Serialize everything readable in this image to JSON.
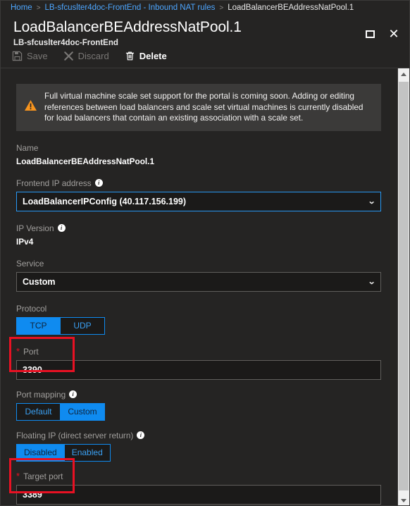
{
  "breadcrumb": {
    "home": "Home",
    "parent": "LB-sfcuslter4doc-FrontEnd - Inbound NAT rules",
    "current": "LoadBalancerBEAddressNatPool.1",
    "separator": ">"
  },
  "header": {
    "title": "LoadBalancerBEAddressNatPool.1",
    "subtitle": "LB-sfcuslter4doc-FrontEnd",
    "maximize_label": "Maximize",
    "close_label": "Close"
  },
  "toolbar": {
    "save_label": "Save",
    "discard_label": "Discard",
    "delete_label": "Delete"
  },
  "warning": {
    "text": "Full virtual machine scale set support for the portal is coming soon. Adding or editing references between load balancers and scale set virtual machines is currently disabled for load balancers that contain an existing association with a scale set."
  },
  "form": {
    "name": {
      "label": "Name",
      "value": "LoadBalancerBEAddressNatPool.1"
    },
    "frontend_ip": {
      "label": "Frontend IP address",
      "value": "LoadBalancerIPConfig (40.117.156.199)"
    },
    "ip_version": {
      "label": "IP Version",
      "value": "IPv4"
    },
    "service": {
      "label": "Service",
      "value": "Custom"
    },
    "protocol": {
      "label": "Protocol",
      "options": [
        "TCP",
        "UDP"
      ],
      "selected": "TCP"
    },
    "port": {
      "label": "Port",
      "required_marker": "*",
      "value": "3390"
    },
    "port_mapping": {
      "label": "Port mapping",
      "options": [
        "Default",
        "Custom"
      ],
      "selected": "Custom"
    },
    "floating_ip": {
      "label": "Floating IP (direct server return)",
      "options": [
        "Disabled",
        "Enabled"
      ],
      "selected": "Disabled"
    },
    "target_port": {
      "label": "Target port",
      "required_marker": "*",
      "value": "3389"
    }
  },
  "icons": {
    "info": "i",
    "chevron_down": "⌄",
    "close": "✕"
  },
  "colors": {
    "accent_blue": "#0f8bf0",
    "link_blue": "#4da6ff",
    "warning_orange": "#f7941e",
    "required_red": "#e81123",
    "annotation_red": "#e81123",
    "panel_bg": "#252423",
    "input_bg": "#1b1a19"
  }
}
